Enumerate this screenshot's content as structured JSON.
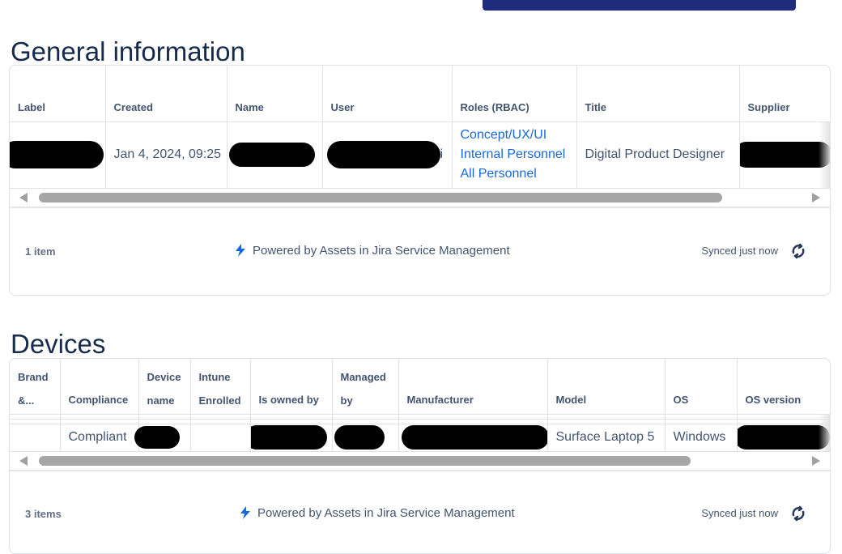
{
  "general": {
    "title": "General information",
    "columns": [
      "Label",
      "Created",
      "Name",
      "User",
      "Roles (RBAC)",
      "Title",
      "Supplier"
    ],
    "row": {
      "created": "Jan 4, 2024, 09:25",
      "user_tail": "i",
      "roles": [
        "Concept/UX/UI",
        "Internal Personnel",
        "All Personnel"
      ],
      "title": "Digital Product Designer"
    },
    "footer": {
      "count": "1 item",
      "powered": "Powered by Assets in Jira Service Management",
      "synced": "Synced just now"
    }
  },
  "devices": {
    "title": "Devices",
    "columns": [
      "Brand &...",
      "Compliance",
      "Device name",
      "Intune Enrolled",
      "Is owned by",
      "Managed by",
      "Manufacturer",
      "Model",
      "OS",
      "OS version"
    ],
    "row": {
      "compliance": "Compliant",
      "model": "Surface Laptop 5",
      "os": "Windows"
    },
    "footer": {
      "count": "3 items",
      "powered": "Powered by Assets in Jira Service Management",
      "synced": "Synced just now"
    }
  },
  "colors": {
    "link": "#1868db",
    "heading": "#172b4d",
    "accent_button": "#1f2b7b"
  },
  "icons": {
    "powered": "lightning-bolt-icon",
    "sync": "refresh-icon"
  }
}
